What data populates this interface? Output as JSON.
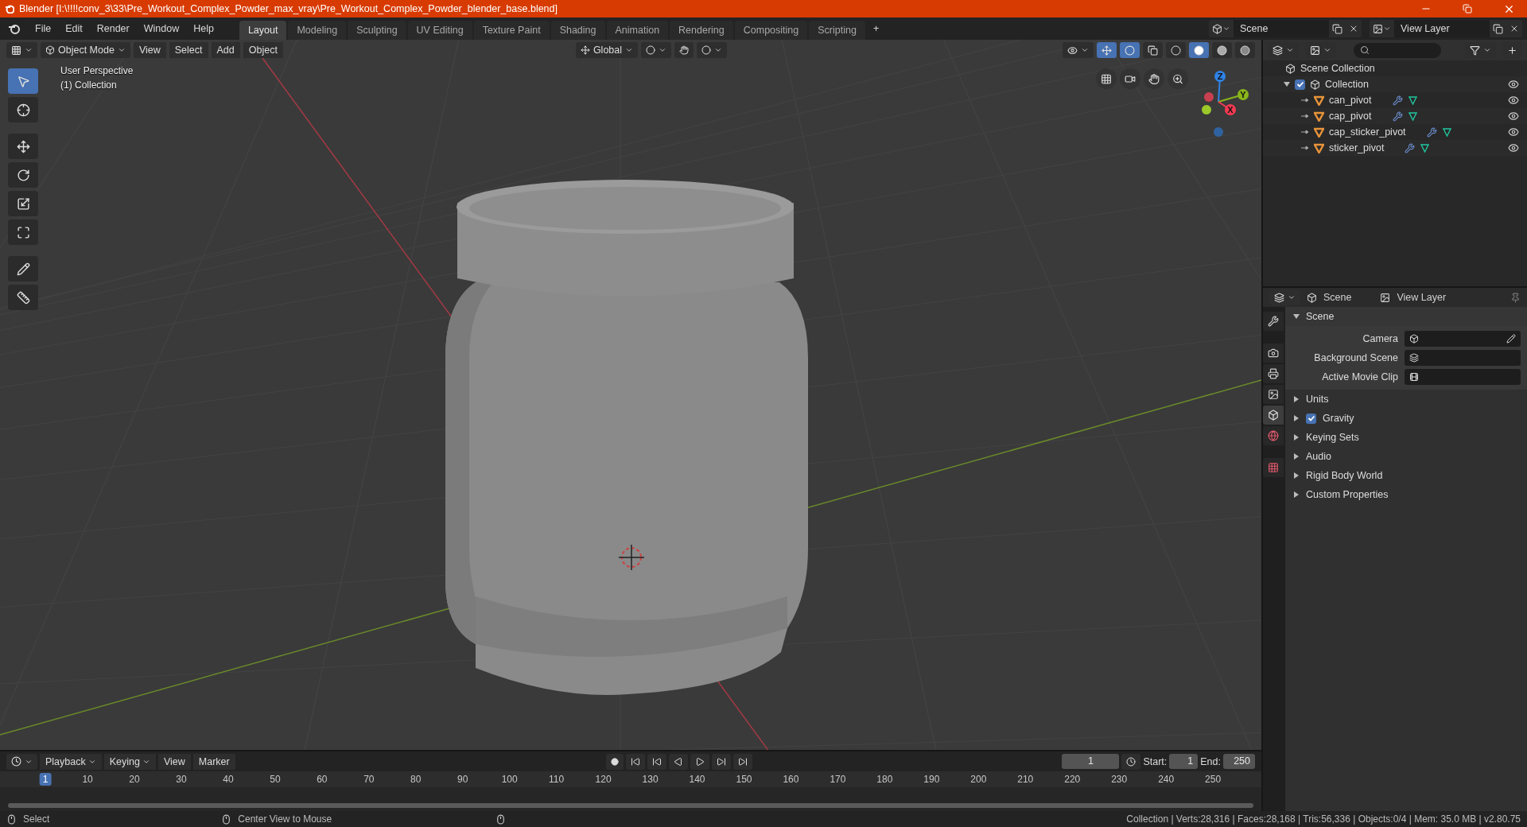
{
  "title_bar": {
    "title": "Blender [I:\\!!!!conv_3\\33\\Pre_Workout_Complex_Powder_max_vray\\Pre_Workout_Complex_Powder_blender_base.blend]"
  },
  "menu": [
    "File",
    "Edit",
    "Render",
    "Window",
    "Help"
  ],
  "workspaces": [
    {
      "label": "Layout",
      "selected": true
    },
    {
      "label": "Modeling",
      "selected": false
    },
    {
      "label": "Sculpting",
      "selected": false
    },
    {
      "label": "UV Editing",
      "selected": false
    },
    {
      "label": "Texture Paint",
      "selected": false
    },
    {
      "label": "Shading",
      "selected": false
    },
    {
      "label": "Animation",
      "selected": false
    },
    {
      "label": "Rendering",
      "selected": false
    },
    {
      "label": "Compositing",
      "selected": false
    },
    {
      "label": "Scripting",
      "selected": false
    }
  ],
  "add_workspace": "+",
  "scene_selector": {
    "value": "Scene"
  },
  "view_layer_selector": {
    "value": "View Layer"
  },
  "viewport": {
    "mode": "Object Mode",
    "menus": [
      "View",
      "Select",
      "Add",
      "Object"
    ],
    "orientation": "Global",
    "overlay_lines": [
      "User Perspective",
      "(1) Collection"
    ],
    "gizmo_axes": [
      {
        "label": "Z",
        "color": "#2f83e6"
      },
      {
        "label": "Y",
        "color": "#8ab51b"
      },
      {
        "label": "X",
        "color": "#f53a53"
      }
    ],
    "shading": [
      {
        "kind": "wireframe",
        "selected": false
      },
      {
        "kind": "solid",
        "selected": true
      },
      {
        "kind": "material",
        "selected": false
      },
      {
        "kind": "rendered",
        "selected": false
      }
    ],
    "tools": [
      {
        "kind": "select",
        "selected": true
      },
      {
        "kind": "cursor",
        "selected": false
      },
      {
        "kind": "move",
        "selected": false
      },
      {
        "kind": "rotate",
        "selected": false
      },
      {
        "kind": "scale",
        "selected": false
      },
      {
        "kind": "transform",
        "selected": false
      },
      {
        "kind": "annotate",
        "selected": false
      },
      {
        "kind": "measure",
        "selected": false
      }
    ]
  },
  "outliner": {
    "root": "Scene Collection",
    "tree": [
      {
        "label": "Collection",
        "checked": true,
        "expanded": true,
        "children": [
          {
            "label": "can_pivot"
          },
          {
            "label": "cap_pivot"
          },
          {
            "label": "cap_sticker_pivot"
          },
          {
            "label": "sticker_pivot"
          }
        ]
      }
    ]
  },
  "properties": {
    "breadcrumb": [
      "Scene",
      "View Layer"
    ],
    "tabs": [
      {
        "kind": "tool",
        "selected": false
      },
      {
        "kind": "render",
        "selected": false
      },
      {
        "kind": "output",
        "selected": false
      },
      {
        "kind": "view_layer",
        "selected": false
      },
      {
        "kind": "scene",
        "selected": true
      },
      {
        "kind": "world",
        "selected": false
      },
      {
        "kind": "texture",
        "selected": false
      }
    ],
    "panels": [
      {
        "title": "Scene",
        "kind": "plain",
        "expanded": true,
        "fields": [
          {
            "label": "Camera",
            "kind": "camera"
          },
          {
            "label": "Background Scene",
            "kind": "scene"
          },
          {
            "label": "Active Movie Clip",
            "kind": "clip"
          }
        ]
      },
      {
        "title": "Units",
        "kind": "plain",
        "expanded": false
      },
      {
        "title": "Gravity",
        "kind": "checkbox",
        "checked": true,
        "expanded": false
      },
      {
        "title": "Keying Sets",
        "kind": "plain",
        "expanded": false
      },
      {
        "title": "Audio",
        "kind": "plain",
        "expanded": false
      },
      {
        "title": "Rigid Body World",
        "kind": "plain",
        "expanded": false
      },
      {
        "title": "Custom Properties",
        "kind": "plain",
        "expanded": false
      }
    ]
  },
  "timeline": {
    "menus": [
      "Playback",
      "Keying",
      "View",
      "Marker"
    ],
    "current_frame": "1",
    "start_label": "Start:",
    "start": "1",
    "end_label": "End:",
    "end": "250",
    "frames": [
      {
        "label": "1",
        "selected": true
      },
      {
        "label": "10",
        "selected": false
      },
      {
        "label": "20",
        "selected": false
      },
      {
        "label": "30",
        "selected": false
      },
      {
        "label": "40",
        "selected": false
      },
      {
        "label": "50",
        "selected": false
      },
      {
        "label": "60",
        "selected": false
      },
      {
        "label": "70",
        "selected": false
      },
      {
        "label": "80",
        "selected": false
      },
      {
        "label": "90",
        "selected": false
      },
      {
        "label": "100",
        "selected": false
      },
      {
        "label": "110",
        "selected": false
      },
      {
        "label": "120",
        "selected": false
      },
      {
        "label": "130",
        "selected": false
      },
      {
        "label": "140",
        "selected": false
      },
      {
        "label": "150",
        "selected": false
      },
      {
        "label": "160",
        "selected": false
      },
      {
        "label": "170",
        "selected": false
      },
      {
        "label": "180",
        "selected": false
      },
      {
        "label": "190",
        "selected": false
      },
      {
        "label": "200",
        "selected": false
      },
      {
        "label": "210",
        "selected": false
      },
      {
        "label": "220",
        "selected": false
      },
      {
        "label": "230",
        "selected": false
      },
      {
        "label": "240",
        "selected": false
      },
      {
        "label": "250",
        "selected": false
      }
    ]
  },
  "status_bar": {
    "hints": [
      "Select",
      "Center View to Mouse"
    ],
    "stats": "Collection | Verts:28,316 | Faces:28,168 | Tris:56,336 | Objects:0/4 | Mem: 35.0 MB | v2.80.75"
  }
}
